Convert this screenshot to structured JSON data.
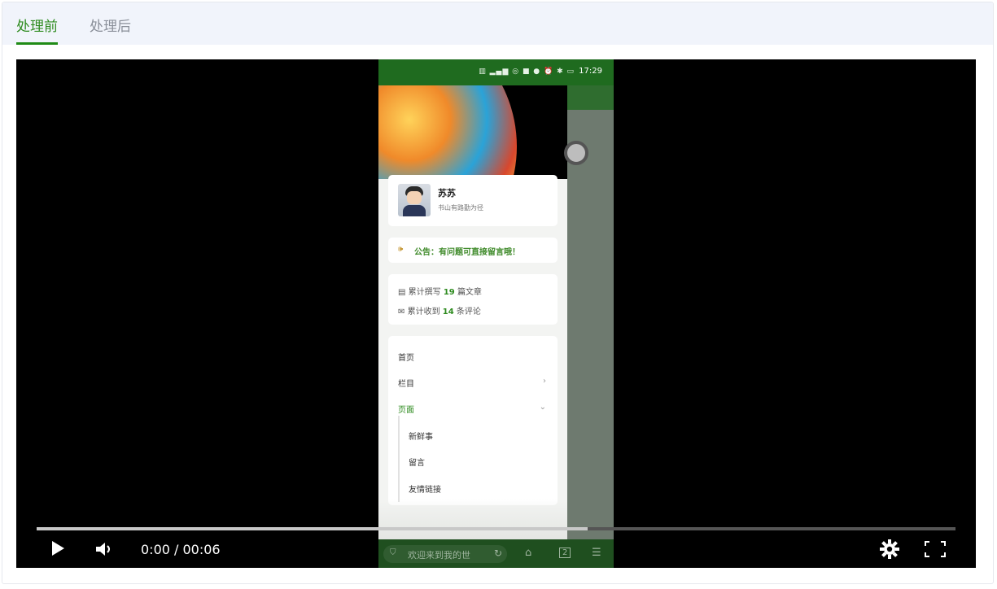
{
  "tabs": [
    {
      "label": "处理前",
      "active": true
    },
    {
      "label": "处理后",
      "active": false
    }
  ],
  "colors": {
    "accent": "#2e8b1f",
    "tabbar_bg": "#f1f4fb",
    "player_bg": "#000000"
  },
  "video": {
    "current_time": "0:00",
    "separator": "/",
    "duration": "00:06",
    "time_display": "0:00 / 00:06",
    "buffered_fraction": 0.6,
    "icons": [
      "play-icon",
      "volume-icon",
      "settings-icon",
      "fullscreen-icon"
    ]
  },
  "phone": {
    "status_time": "17:29",
    "profile": {
      "name": "苏苏",
      "motto": "书山有路勤为径"
    },
    "notice": "公告：有问题可直接留言哦！",
    "stats": [
      {
        "prefix": "累计撰写",
        "count": "19",
        "suffix": "篇文章"
      },
      {
        "prefix": "累计收到",
        "count": "14",
        "suffix": "条评论"
      }
    ],
    "menu": [
      {
        "label": "首页"
      },
      {
        "label": "栏目"
      },
      {
        "label": "页面"
      }
    ],
    "submenu": [
      {
        "label": "新鲜事"
      },
      {
        "label": "留言"
      },
      {
        "label": "友情链接"
      }
    ],
    "bottom_bar": {
      "input_text": "欢迎来到我的世",
      "tab_count": "2"
    }
  }
}
